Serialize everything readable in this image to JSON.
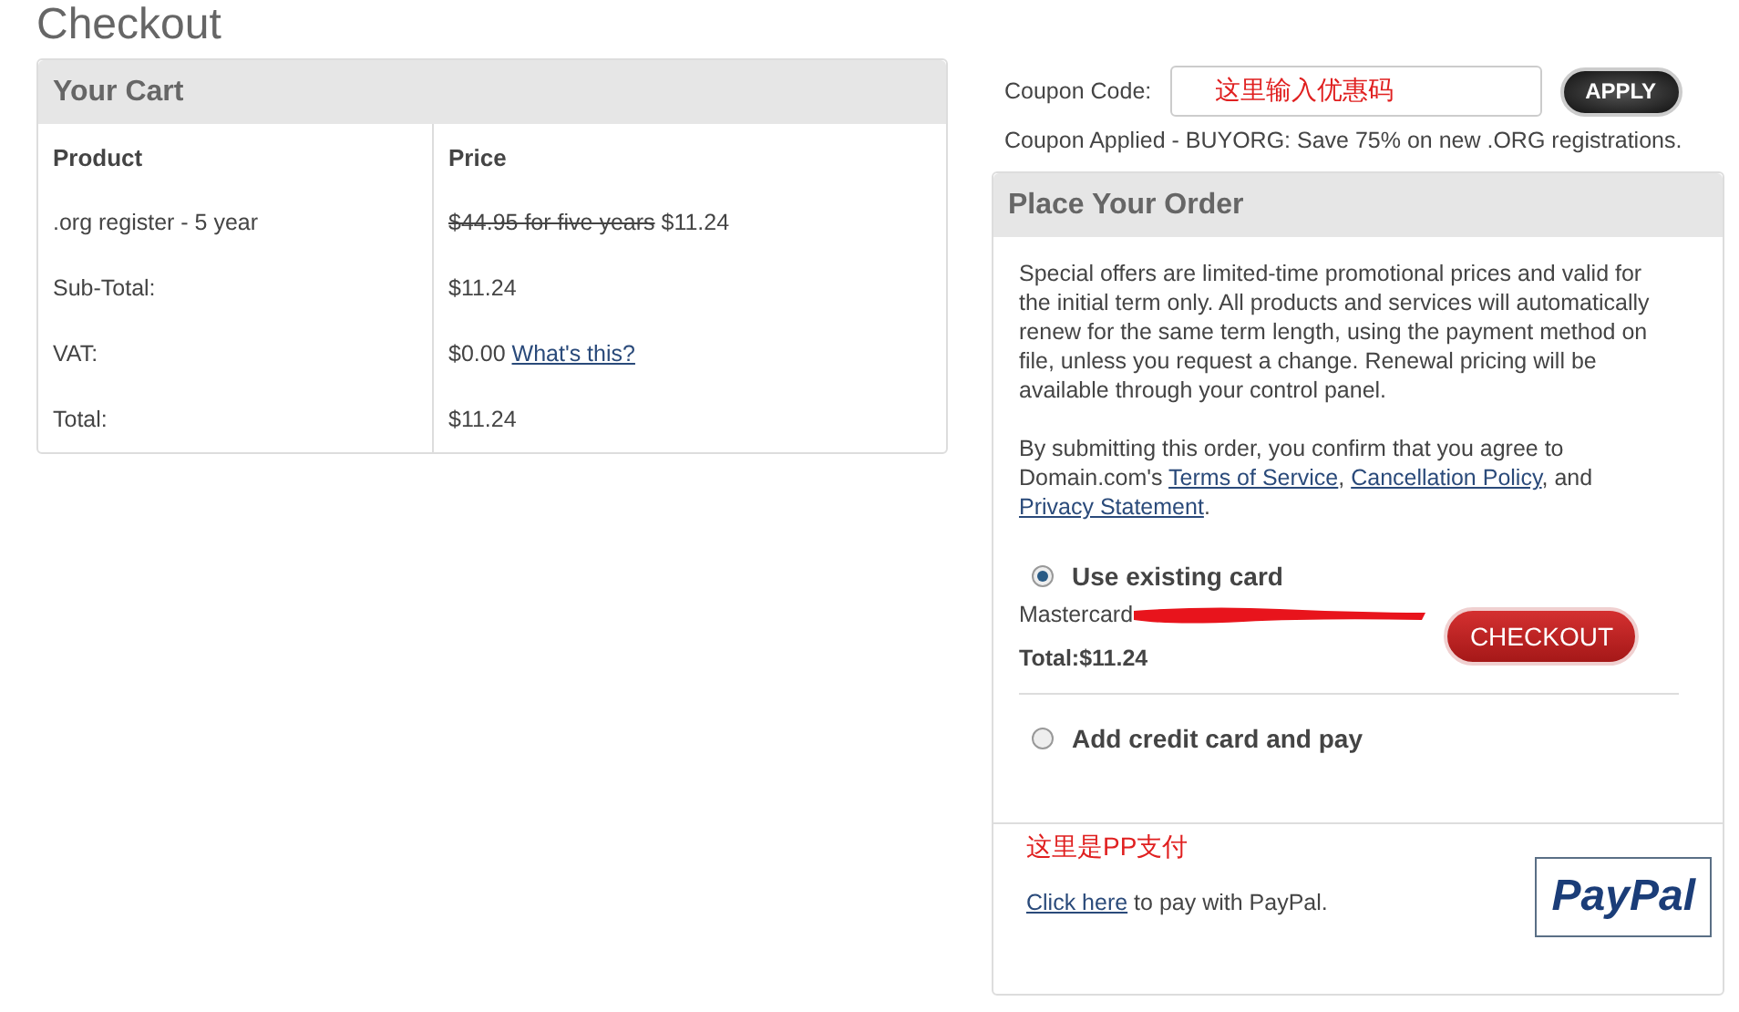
{
  "page": {
    "title": "Checkout"
  },
  "cart": {
    "title": "Your Cart",
    "columns": [
      "Product",
      "Price"
    ],
    "rows": [
      {
        "label": ".org register - 5 year",
        "old_price": "$44.95 for five years",
        "value": "$11.24"
      },
      {
        "label": "Sub-Total:",
        "value": "$11.24"
      },
      {
        "label": "VAT:",
        "value": "$0.00",
        "link": "What's this?"
      },
      {
        "label": "Total:",
        "value": "$11.24"
      }
    ]
  },
  "coupon": {
    "label": "Coupon Code:",
    "value": "这里输入优惠码",
    "button": "APPLY",
    "message": "Coupon Applied - BUYORG: Save 75% on new .ORG registrations."
  },
  "order": {
    "title": "Place Your Order",
    "notice": "Special offers are limited-time promotional prices and valid for the initial term only. All products and services will automatically renew for the same term length, using the payment method on file, unless you request a change. Renewal pricing will be available through your control panel.",
    "agreement": [
      {
        "kind": "text",
        "text": "By submitting this order, you confirm that you agree to Domain.com's "
      },
      {
        "kind": "link",
        "text": "Terms of Service"
      },
      {
        "kind": "text",
        "text": ", "
      },
      {
        "kind": "link",
        "text": "Cancellation Policy"
      },
      {
        "kind": "text",
        "text": ", and "
      },
      {
        "kind": "link",
        "text": "Privacy Statement"
      },
      {
        "kind": "text",
        "text": "."
      }
    ],
    "options": [
      {
        "label": "Use existing card",
        "selected": true,
        "card": "Mastercard",
        "redacted": true,
        "total": "Total:$11.24",
        "button": "CHECKOUT"
      },
      {
        "label": "Add credit card and pay",
        "selected": false
      }
    ],
    "paypal": {
      "note": "这里是PP支付",
      "link": "Click here",
      "text": " to pay with PayPal.",
      "logo": "PayPal"
    }
  }
}
